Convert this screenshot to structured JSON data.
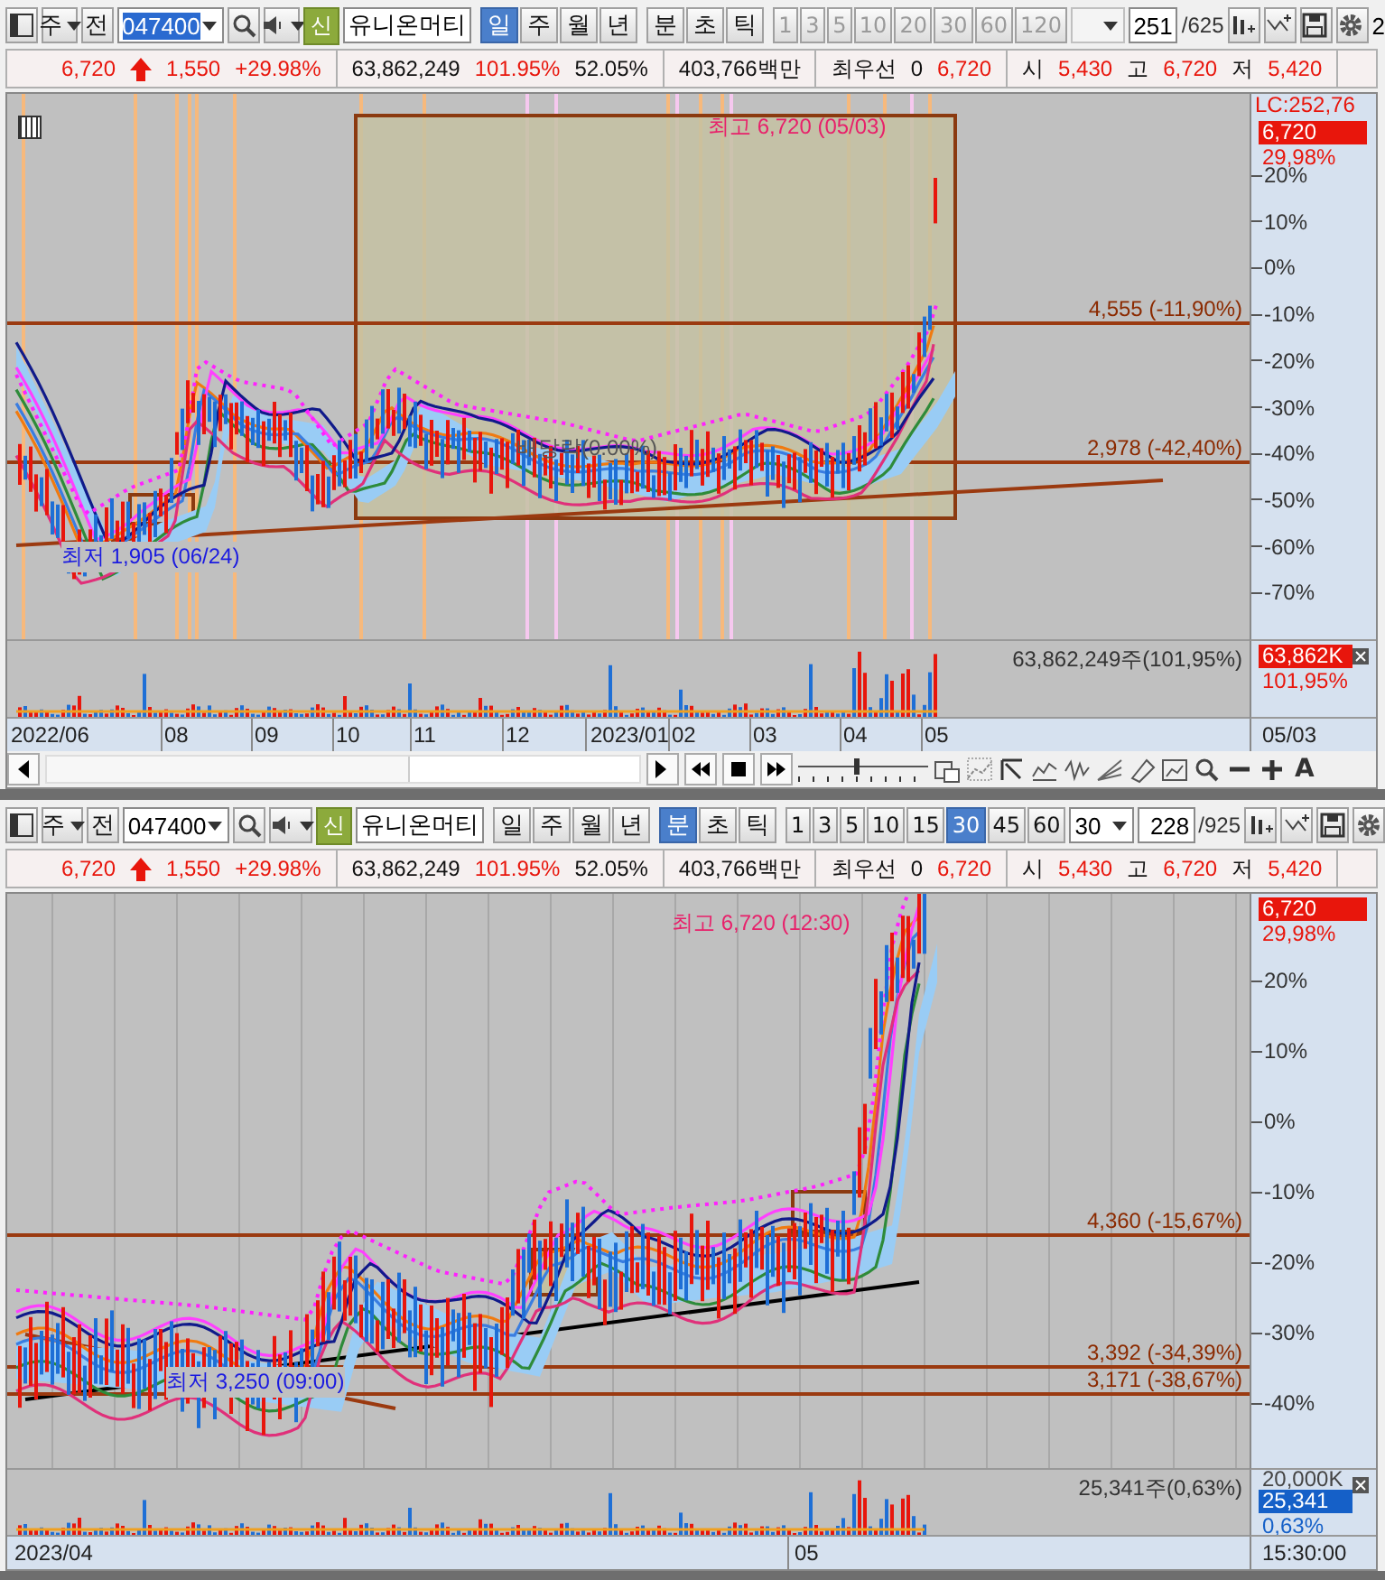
{
  "panels": [
    {
      "toolbar": {
        "market": "주",
        "prev": "전",
        "code": "047400",
        "code_selected": true,
        "badge": "신",
        "name": "유니온머티",
        "periods": [
          {
            "label": "일",
            "selected": true
          },
          {
            "label": "주",
            "selected": false
          },
          {
            "label": "월",
            "selected": false
          },
          {
            "label": "년",
            "selected": false
          }
        ],
        "units": [
          {
            "label": "분",
            "selected": false
          },
          {
            "label": "초",
            "selected": false
          },
          {
            "label": "틱",
            "selected": false
          }
        ],
        "intervals": [
          {
            "label": "1",
            "selected": false
          },
          {
            "label": "3",
            "selected": false
          },
          {
            "label": "5",
            "selected": false
          },
          {
            "label": "10",
            "selected": false
          },
          {
            "label": "20",
            "selected": false
          },
          {
            "label": "30",
            "selected": false
          },
          {
            "label": "60",
            "selected": false
          },
          {
            "label": "120",
            "selected": false
          }
        ],
        "intervals_disabled": true,
        "combo": {
          "disabled": true
        },
        "count": "251",
        "total": "/625",
        "edge_text": "2"
      },
      "quote": [
        [
          {
            "text": "6,720",
            "kind": "up"
          },
          {
            "kind": "arrow-up"
          },
          {
            "text": "1,550",
            "kind": "up"
          },
          {
            "text": "+29.98%",
            "kind": "up"
          }
        ],
        [
          {
            "text": "63,862,249",
            "kind": "plain"
          },
          {
            "text": "101.95%",
            "kind": "up"
          },
          {
            "text": "52.05%",
            "kind": "plain"
          }
        ],
        [
          {
            "text": "403,766백만",
            "kind": "plain"
          }
        ],
        [
          {
            "text": "최우선",
            "kind": "plain"
          },
          {
            "text": "0",
            "kind": "plain"
          },
          {
            "text": "6,720",
            "kind": "up"
          }
        ],
        [
          {
            "text": "시",
            "kind": "plain"
          },
          {
            "text": "5,430",
            "kind": "up"
          },
          {
            "text": "고",
            "kind": "plain"
          },
          {
            "text": "6,720",
            "kind": "up"
          },
          {
            "text": "저",
            "kind": "plain"
          },
          {
            "text": "5,420",
            "kind": "up"
          }
        ]
      ],
      "chart": {
        "axis_label": "LC:252,76",
        "price_tag": "6,720",
        "change": "29,98%",
        "yticks": [
          "20%",
          "10%",
          "0%",
          "-10%",
          "-20%",
          "-30%",
          "-40%",
          "-50%",
          "-60%",
          "-70%"
        ],
        "levels": [
          "4,555 (-11,90%)",
          "2,978 (-42,40%)"
        ],
        "annotations": [
          {
            "text": "최고 6,720 (05/03)",
            "kind": "high"
          },
          {
            "text": "최저 1,905 (06/24)",
            "kind": "low"
          },
          {
            "text": "배당락(0.00%)",
            "kind": "event"
          }
        ],
        "volume": {
          "label": "63,862,249주(101,95%)",
          "tag": "63,862K",
          "color": "#e8160c",
          "ratio": "101,95%"
        },
        "dates": [
          "2022/06",
          "08",
          "09",
          "10",
          "11",
          "12",
          "2023/01",
          "02",
          "03",
          "04",
          "05"
        ],
        "cursor": "05/03"
      },
      "navigator": {
        "font_button": "A",
        "zoom": {
          "level": 0.45
        }
      }
    },
    {
      "toolbar": {
        "market": "주",
        "prev": "전",
        "code": "047400",
        "code_selected": false,
        "badge": "신",
        "name": "유니온머티",
        "periods": [
          {
            "label": "일",
            "selected": false
          },
          {
            "label": "주",
            "selected": false
          },
          {
            "label": "월",
            "selected": false
          },
          {
            "label": "년",
            "selected": false
          }
        ],
        "units": [
          {
            "label": "분",
            "selected": true
          },
          {
            "label": "초",
            "selected": false
          },
          {
            "label": "틱",
            "selected": false
          }
        ],
        "intervals": [
          {
            "label": "1",
            "selected": false
          },
          {
            "label": "3",
            "selected": false
          },
          {
            "label": "5",
            "selected": false
          },
          {
            "label": "10",
            "selected": false
          },
          {
            "label": "15",
            "selected": false
          },
          {
            "label": "30",
            "selected": true
          },
          {
            "label": "45",
            "selected": false
          },
          {
            "label": "60",
            "selected": false
          }
        ],
        "intervals_disabled": false,
        "combo": {
          "value": "30",
          "disabled": false
        },
        "count": "228",
        "total": "/925"
      },
      "quote": [
        [
          {
            "text": "6,720",
            "kind": "up"
          },
          {
            "kind": "arrow-up"
          },
          {
            "text": "1,550",
            "kind": "up"
          },
          {
            "text": "+29.98%",
            "kind": "up"
          }
        ],
        [
          {
            "text": "63,862,249",
            "kind": "plain"
          },
          {
            "text": "101.95%",
            "kind": "up"
          },
          {
            "text": "52.05%",
            "kind": "plain"
          }
        ],
        [
          {
            "text": "403,766백만",
            "kind": "plain"
          }
        ],
        [
          {
            "text": "최우선",
            "kind": "plain"
          },
          {
            "text": "0",
            "kind": "plain"
          },
          {
            "text": "6,720",
            "kind": "up"
          }
        ],
        [
          {
            "text": "시",
            "kind": "plain"
          },
          {
            "text": "5,430",
            "kind": "up"
          },
          {
            "text": "고",
            "kind": "plain"
          },
          {
            "text": "6,720",
            "kind": "up"
          },
          {
            "text": "저",
            "kind": "plain"
          },
          {
            "text": "5,420",
            "kind": "up"
          }
        ]
      ],
      "chart": {
        "price_tag": "6,720",
        "change": "29,98%",
        "yticks": [
          "20%",
          "10%",
          "0%",
          "-10%",
          "-20%",
          "-30%",
          "-40%"
        ],
        "levels": [
          "4,360 (-15,67%)",
          "3,392 (-34,39%)",
          "3,171 (-38,67%)"
        ],
        "annotations": [
          {
            "text": "최고 6,720 (12:30)",
            "kind": "high"
          },
          {
            "text": "최저 3,250 (09:00)",
            "kind": "low"
          }
        ],
        "volume": {
          "label": "25,341주(0,63%)",
          "scale": "20,000K",
          "tag": "25,341",
          "color": "#1560c8",
          "ratio": "0,63%"
        },
        "dates": [
          "2023/04",
          "05"
        ],
        "cursor": "15:30:00"
      }
    }
  ]
}
